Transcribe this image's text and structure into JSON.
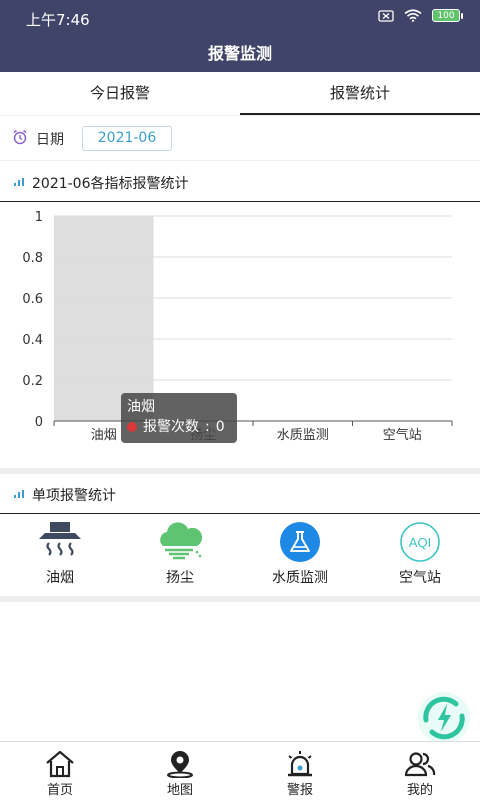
{
  "status_bar": {
    "time": "上午7:46",
    "battery": "100"
  },
  "header": {
    "title": "报警监测"
  },
  "tabs": [
    {
      "label": "今日报警",
      "active": false
    },
    {
      "label": "报警统计",
      "active": true
    }
  ],
  "date_filter": {
    "label": "日期",
    "value": "2021-06"
  },
  "chart_section": {
    "title": "2021-06各指标报警统计"
  },
  "chart_data": {
    "type": "bar",
    "categories": [
      "油烟",
      "扬尘",
      "水质监测",
      "空气站"
    ],
    "values": [
      0,
      0,
      0,
      0
    ],
    "y_ticks": [
      "0",
      "0.2",
      "0.4",
      "0.6",
      "0.8",
      "1"
    ],
    "ylim": [
      0,
      1
    ],
    "grid": true,
    "highlighted_category": "油烟",
    "tooltip": {
      "title": "油烟",
      "series_label": "报警次数",
      "value": "0",
      "color": "#d83a3a"
    }
  },
  "single_section": {
    "title": "单项报警统计"
  },
  "single_items": [
    {
      "label": "油烟",
      "icon": "range-hood-icon"
    },
    {
      "label": "扬尘",
      "icon": "dust-cloud-icon"
    },
    {
      "label": "水质监测",
      "icon": "flask-icon"
    },
    {
      "label": "空气站",
      "icon": "aqi-icon",
      "icon_text": "AQI"
    }
  ],
  "bottom_nav": [
    {
      "label": "首页",
      "icon": "home-icon"
    },
    {
      "label": "地图",
      "icon": "map-pin-icon"
    },
    {
      "label": "警报",
      "icon": "alarm-light-icon"
    },
    {
      "label": "我的",
      "icon": "users-icon"
    }
  ],
  "colors": {
    "header_bg": "#3f4468",
    "accent_blue": "#3a9fd0",
    "highlight_bar": "#dedede",
    "fab_green": "#2ec4a0",
    "aqi_teal": "#3cc4c4"
  }
}
